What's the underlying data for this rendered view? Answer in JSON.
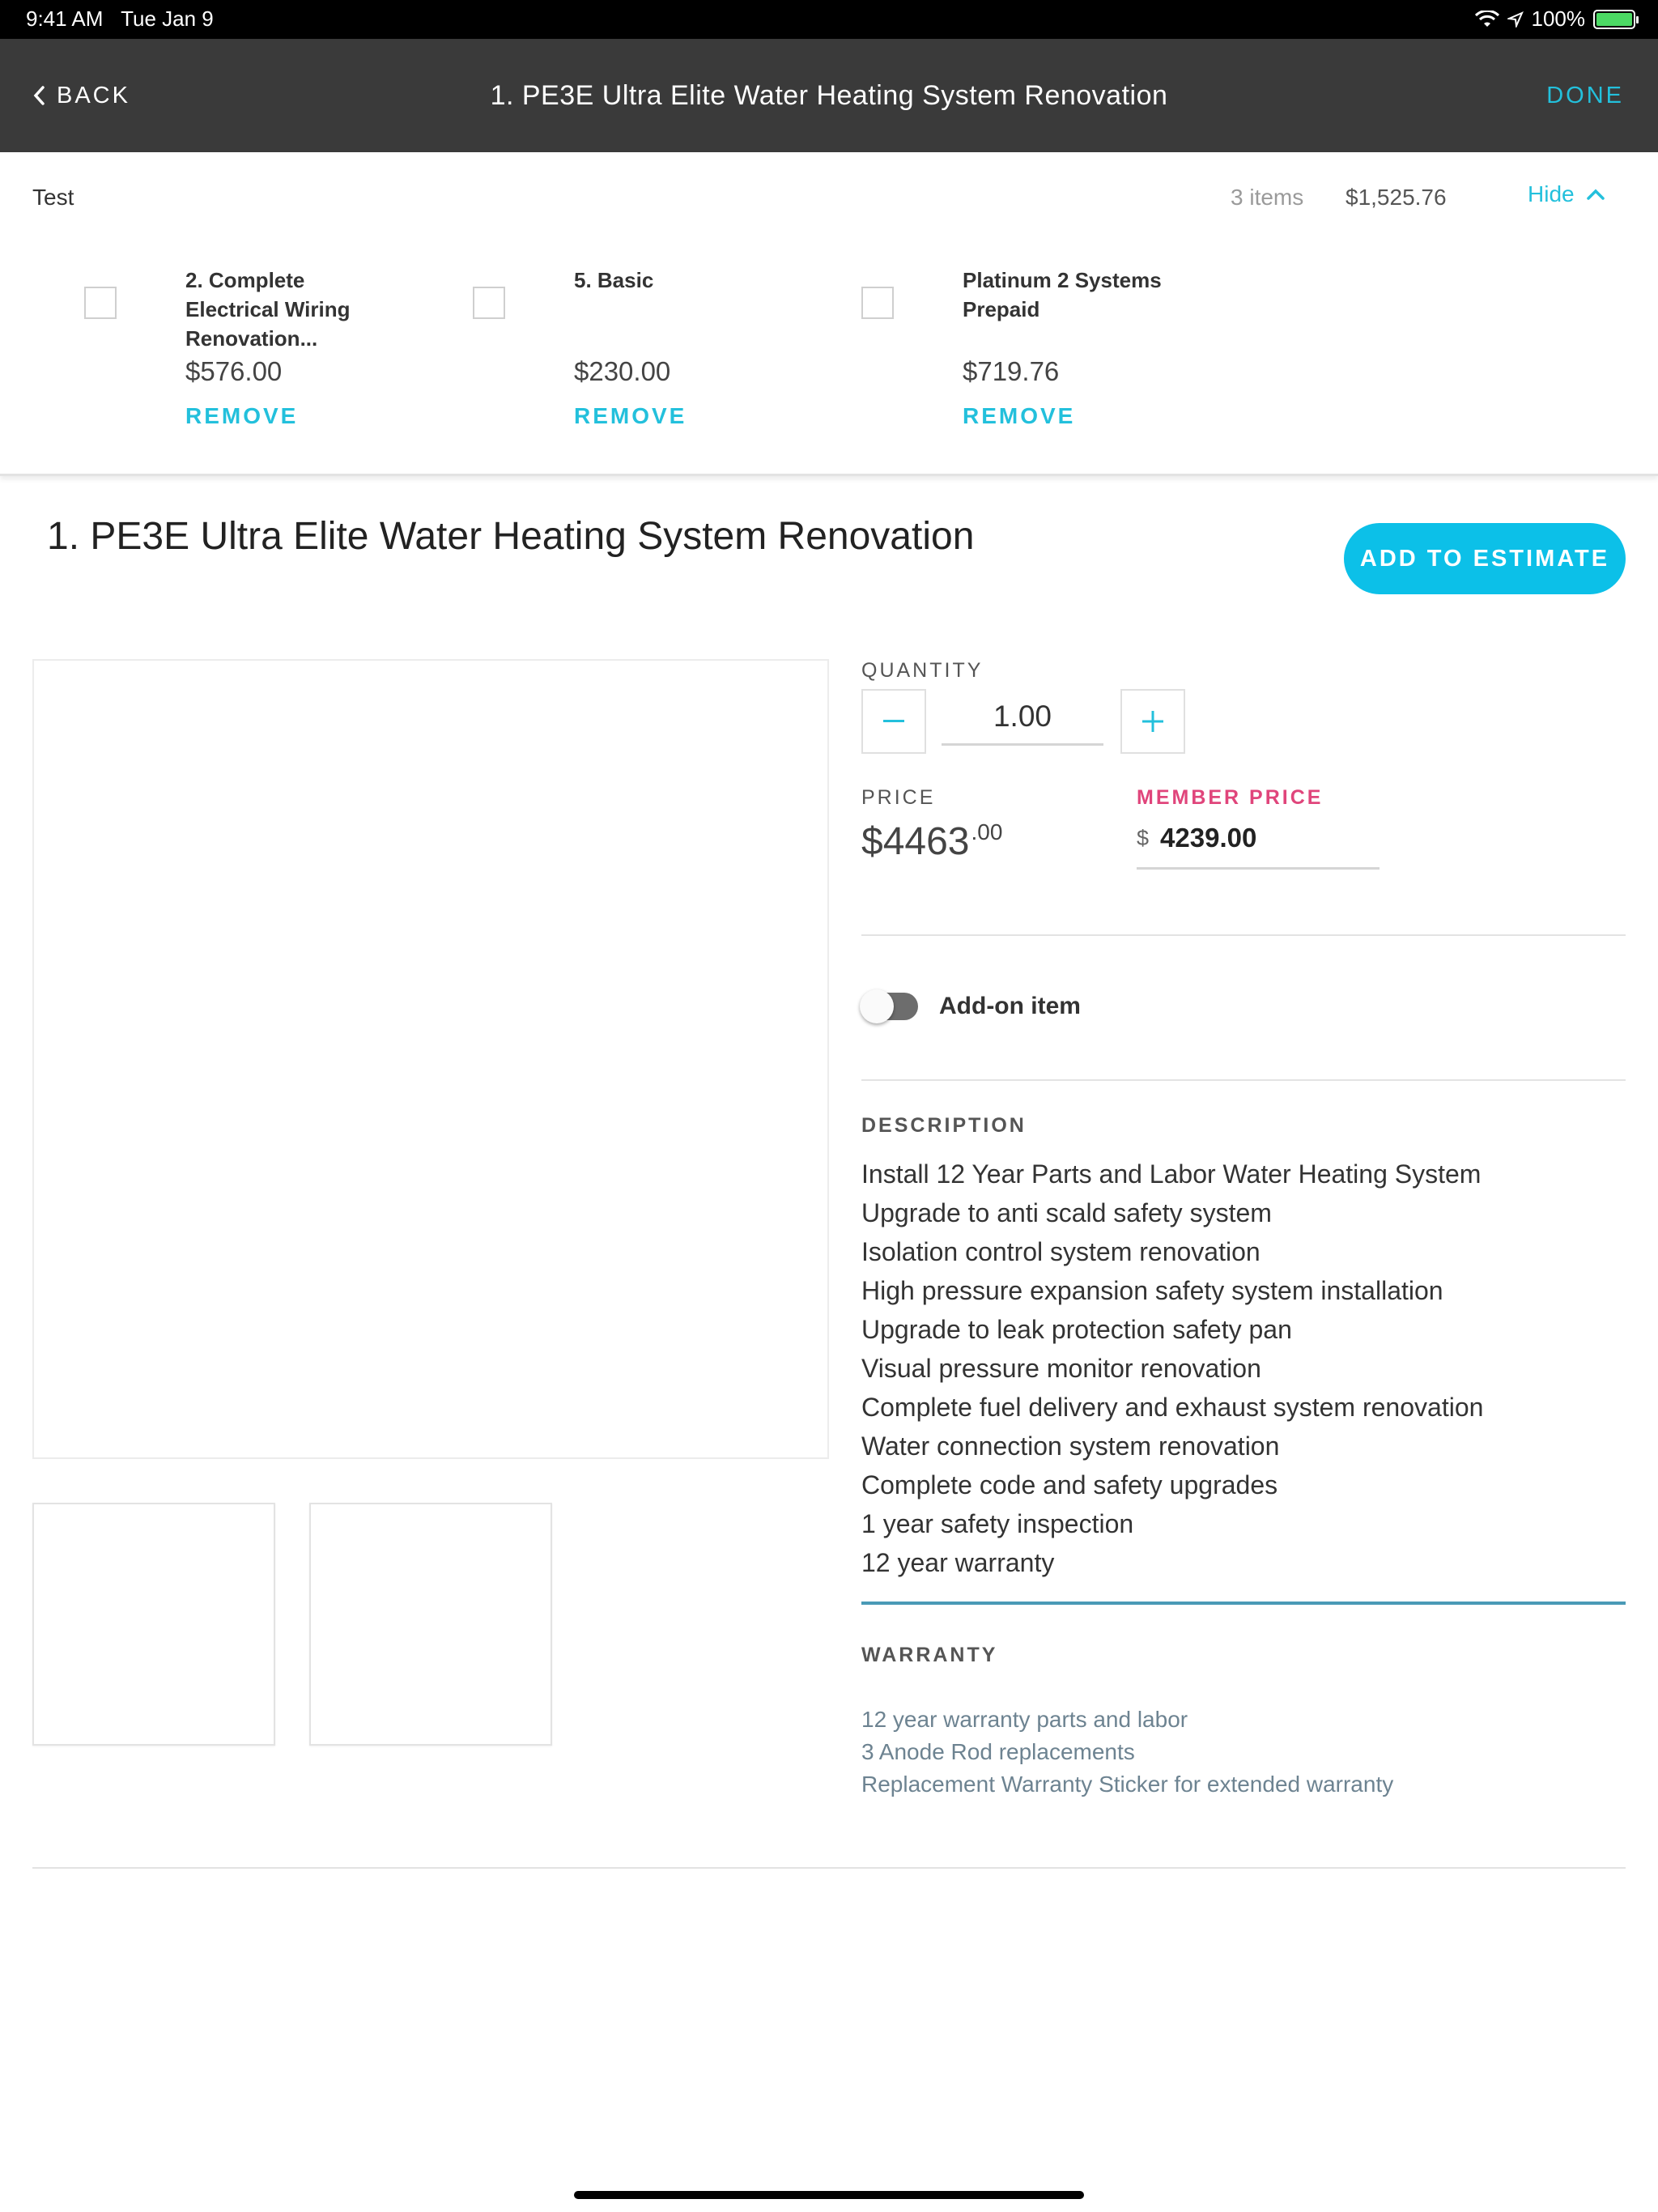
{
  "status_bar": {
    "time": "9:41 AM",
    "date": "Tue Jan 9",
    "battery": "100%"
  },
  "nav": {
    "back_label": "BACK",
    "title": "1. PE3E Ultra Elite Water Heating System Renovation",
    "done_label": "DONE",
    "accent_color": "#23c0dc"
  },
  "estimate": {
    "name": "Test",
    "count": "3 items",
    "total": "$1,525.76",
    "hide_label": "Hide",
    "items": [
      {
        "name": "2. Complete Electrical Wiring Renovation...",
        "price": "$576.00",
        "remove_label": "REMOVE"
      },
      {
        "name": "5. Basic",
        "price": "$230.00",
        "remove_label": "REMOVE"
      },
      {
        "name": "Platinum 2 Systems Prepaid",
        "price": "$719.76",
        "remove_label": "REMOVE"
      }
    ]
  },
  "product": {
    "title": "1. PE3E Ultra Elite Water Heating System Renovation",
    "add_button_label": "ADD TO ESTIMATE",
    "quantity_label": "QUANTITY",
    "quantity_value": "1.00",
    "price_label": "PRICE",
    "price_main": "$4463",
    "price_cents": ".00",
    "member_price_label": "MEMBER PRICE",
    "member_price_currency": "$",
    "member_price_value": "4239.00",
    "addon_label": "Add-on item",
    "addon_enabled": false,
    "description_label": "DESCRIPTION",
    "description": [
      "Install 12 Year Parts and Labor Water Heating System",
      "Upgrade to anti scald safety system",
      "Isolation control system renovation",
      "High pressure expansion safety system installation",
      "Upgrade to leak protection safety pan",
      "Visual pressure monitor renovation",
      "Complete fuel delivery and exhaust system renovation",
      "Water connection system renovation",
      "Complete code and safety upgrades",
      "1 year safety inspection",
      "12 year warranty"
    ],
    "warranty_label": "WARRANTY",
    "warranty": [
      "12 year warranty parts and labor",
      "3 Anode Rod replacements",
      "Replacement Warranty Sticker for extended warranty"
    ],
    "member_price_color": "#e0457b"
  }
}
